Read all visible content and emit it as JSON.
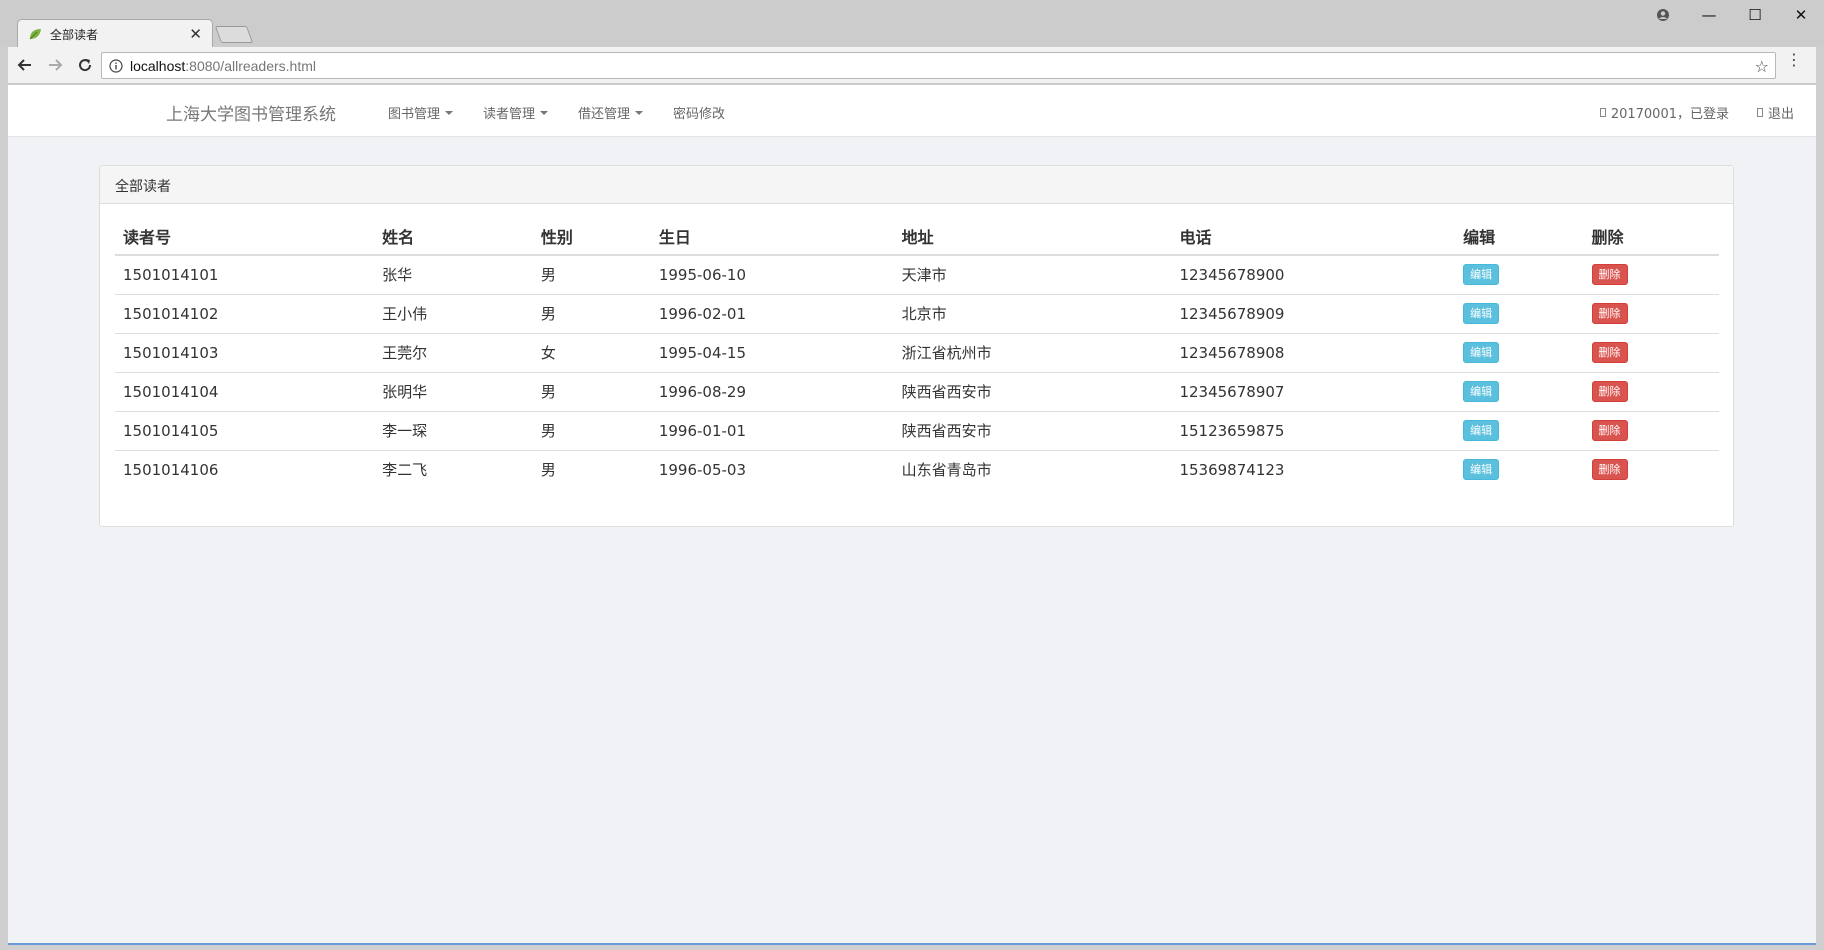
{
  "browser": {
    "tab_title": "全部读者",
    "tab_close": "✕",
    "url_host": "localhost",
    "url_rest": ":8080/allreaders.html",
    "window_controls": {
      "account": "●",
      "minimize": "—",
      "maximize": "☐",
      "close": "✕"
    }
  },
  "navbar": {
    "brand": "上海大学图书管理系统",
    "menu": [
      {
        "label": "图书管理"
      },
      {
        "label": "读者管理"
      },
      {
        "label": "借还管理"
      },
      {
        "label": "密码修改"
      }
    ],
    "user_status": "20170001，已登录",
    "logout": "退出"
  },
  "panel": {
    "title": "全部读者",
    "columns": [
      "读者号",
      "姓名",
      "性别",
      "生日",
      "地址",
      "电话",
      "编辑",
      "删除"
    ],
    "edit_label": "编辑",
    "delete_label": "删除",
    "rows": [
      {
        "id": "1501014101",
        "name": "张华",
        "sex": "男",
        "birthday": "1995-06-10",
        "address": "天津市",
        "phone": "12345678900"
      },
      {
        "id": "1501014102",
        "name": "王小伟",
        "sex": "男",
        "birthday": "1996-02-01",
        "address": "北京市",
        "phone": "12345678909"
      },
      {
        "id": "1501014103",
        "name": "王莞尔",
        "sex": "女",
        "birthday": "1995-04-15",
        "address": "浙江省杭州市",
        "phone": "12345678908"
      },
      {
        "id": "1501014104",
        "name": "张明华",
        "sex": "男",
        "birthday": "1996-08-29",
        "address": "陕西省西安市",
        "phone": "12345678907"
      },
      {
        "id": "1501014105",
        "name": "李一琛",
        "sex": "男",
        "birthday": "1996-01-01",
        "address": "陕西省西安市",
        "phone": "15123659875"
      },
      {
        "id": "1501014106",
        "name": "李二飞",
        "sex": "男",
        "birthday": "1996-05-03",
        "address": "山东省青岛市",
        "phone": "15369874123"
      }
    ]
  },
  "colors": {
    "edit_button": "#5bc0de",
    "delete_button": "#d9534f",
    "page_background": "#f0f2f5"
  }
}
